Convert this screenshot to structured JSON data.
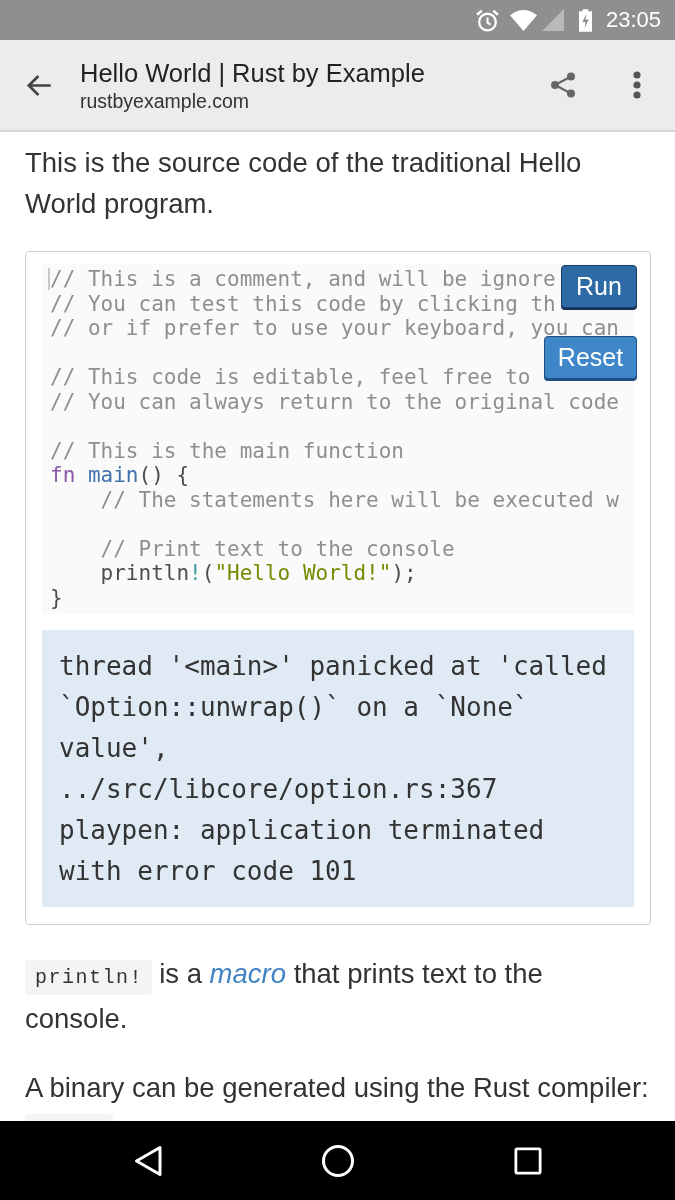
{
  "status_bar": {
    "time": "23:05"
  },
  "app_bar": {
    "title": "Hello World | Rust by Example",
    "subtitle": "rustbyexample.com"
  },
  "intro": "This is the source code of the traditional Hello World program.",
  "playground": {
    "lines": [
      {
        "kind": "code",
        "caret": true,
        "tokens": [
          {
            "kind": "comment",
            "text": "// This is a comment, and will be ignore"
          }
        ]
      },
      {
        "kind": "code",
        "caret": false,
        "tokens": [
          {
            "kind": "comment",
            "text": "// You can test this code by clicking th"
          }
        ]
      },
      {
        "kind": "code",
        "caret": false,
        "tokens": [
          {
            "kind": "comment",
            "text": "// or if prefer to use your keyboard, you can"
          }
        ]
      },
      {
        "kind": "blank",
        "caret": false
      },
      {
        "kind": "code",
        "caret": false,
        "tokens": [
          {
            "kind": "comment",
            "text": "// This code is editable, feel free to"
          }
        ]
      },
      {
        "kind": "code",
        "caret": false,
        "tokens": [
          {
            "kind": "comment",
            "text": "// You can always return to the original code"
          }
        ]
      },
      {
        "kind": "blank",
        "caret": false
      },
      {
        "kind": "code",
        "caret": false,
        "tokens": [
          {
            "kind": "comment",
            "text": "// This is the main function"
          }
        ]
      },
      {
        "kind": "code",
        "caret": false,
        "tokens": [
          {
            "kind": "keyword",
            "text": "fn"
          },
          {
            "kind": "function",
            "text": " main"
          },
          {
            "kind": "plain",
            "text": "() {"
          }
        ],
        "children": [
          {
            "kind": "code",
            "caret": false,
            "tokens": [
              {
                "kind": "comment",
                "text": "// The statements here will be executed w"
              }
            ]
          },
          {
            "kind": "blank",
            "caret": false
          },
          {
            "kind": "code",
            "caret": false,
            "tokens": [
              {
                "kind": "comment",
                "text": "// Print text to the console"
              }
            ]
          },
          {
            "kind": "code",
            "caret": false,
            "tokens": [
              {
                "kind": "plain",
                "text": "println"
              },
              {
                "kind": "macro",
                "text": "!"
              },
              {
                "kind": "plain",
                "text": "("
              },
              {
                "kind": "string",
                "text": "\"Hello World!\""
              },
              {
                "kind": "plain",
                "text": ");"
              }
            ]
          }
        ]
      },
      {
        "kind": "code",
        "caret": false,
        "tokens": [
          {
            "kind": "plain",
            "text": "}"
          }
        ]
      }
    ],
    "buttons": [
      {
        "label": "Run",
        "pressed": true
      },
      {
        "label": "Reset",
        "pressed": false
      }
    ],
    "output": [
      "thread '<main>' panicked at 'called",
      "`Option::unwrap()` on a `None`",
      "value',",
      "../src/libcore/option.rs:367",
      "playpen: application terminated",
      "with error code 101"
    ]
  },
  "paragraphs": [
    {
      "parts": [
        {
          "kind": "code",
          "text": "println!"
        },
        {
          "kind": "text",
          "text": " is a "
        },
        {
          "kind": "link",
          "text": "macro"
        },
        {
          "kind": "text",
          "text": " that prints text to the console."
        }
      ]
    },
    {
      "parts": [
        {
          "kind": "text",
          "text": "A binary can be generated using the Rust compiler:"
        }
      ]
    }
  ]
}
